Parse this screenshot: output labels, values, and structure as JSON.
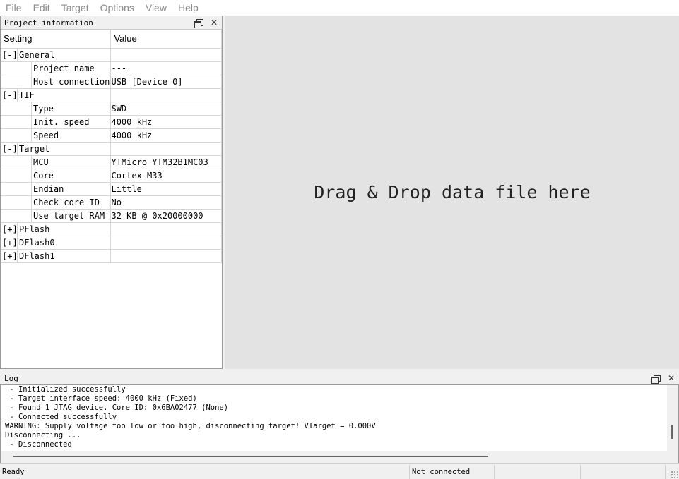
{
  "menu": [
    "File",
    "Edit",
    "Target",
    "Options",
    "View",
    "Help"
  ],
  "project_panel": {
    "title": "Project information",
    "headers": {
      "setting": "Setting",
      "value": "Value"
    },
    "rows": [
      {
        "type": "group",
        "expander": "[-]",
        "label": "General",
        "value": ""
      },
      {
        "type": "child",
        "label": "Project name",
        "value": "---"
      },
      {
        "type": "child",
        "label": "Host connection",
        "value": "USB [Device 0]"
      },
      {
        "type": "group",
        "expander": "[-]",
        "label": "TIF",
        "value": ""
      },
      {
        "type": "child",
        "label": "Type",
        "value": "SWD"
      },
      {
        "type": "child",
        "label": "Init. speed",
        "value": "4000 kHz"
      },
      {
        "type": "child",
        "label": "Speed",
        "value": "4000 kHz"
      },
      {
        "type": "group",
        "expander": "[-]",
        "label": "Target",
        "value": ""
      },
      {
        "type": "child",
        "label": "MCU",
        "value": "YTMicro YTM32B1MC03"
      },
      {
        "type": "child",
        "label": "Core",
        "value": "Cortex-M33"
      },
      {
        "type": "child",
        "label": "Endian",
        "value": "Little"
      },
      {
        "type": "child",
        "label": "Check core ID",
        "value": "No"
      },
      {
        "type": "child",
        "label": "Use target RAM",
        "value": "32 KB @ 0x20000000"
      },
      {
        "type": "group",
        "expander": "[+]",
        "label": "PFlash",
        "value": ""
      },
      {
        "type": "group",
        "expander": "[+]",
        "label": "DFlash0",
        "value": ""
      },
      {
        "type": "group",
        "expander": "[+]",
        "label": "DFlash1",
        "value": ""
      }
    ]
  },
  "drop_area": {
    "text": "Drag & Drop data file here"
  },
  "log": {
    "title": "Log",
    "lines": [
      " - Initialized successfully",
      " - Target interface speed: 4000 kHz (Fixed)",
      " - Found 1 JTAG device. Core ID: 0x6BA02477 (None)",
      " - Connected successfully",
      "WARNING: Supply voltage too low or too high, disconnecting target! VTarget = 0.000V",
      "Disconnecting ...",
      " - Disconnected"
    ]
  },
  "status": {
    "left": "Ready",
    "connection": "Not connected",
    "seg3": "",
    "seg4": "",
    "seg5": ""
  }
}
